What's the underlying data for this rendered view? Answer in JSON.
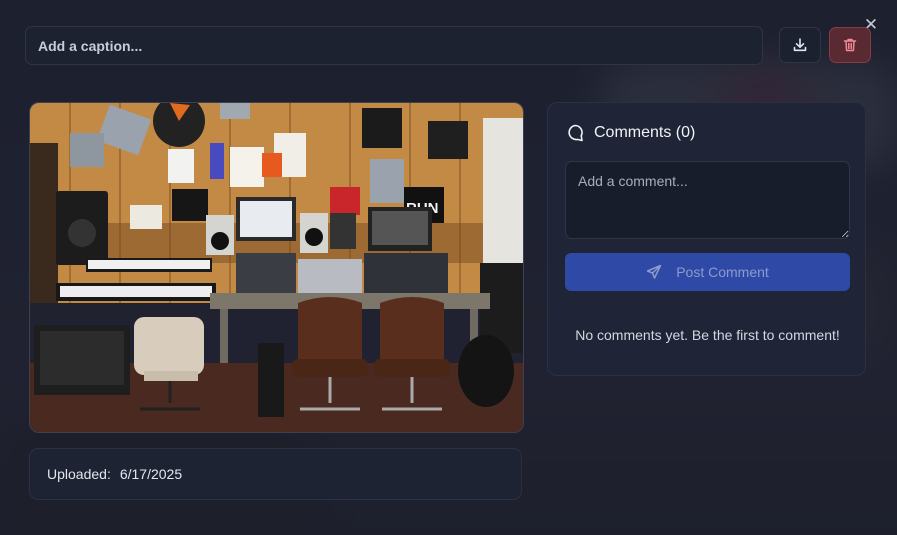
{
  "modal": {
    "caption": {
      "placeholder": "Add a caption...",
      "value": ""
    },
    "close_icon": "close-icon",
    "download_icon": "download-icon",
    "delete_icon": "trash-icon",
    "photo": {
      "description": "recording studio with keyboards, mixing consoles, speakers, monitors and two brown chairs",
      "badge": "RUN"
    },
    "meta": {
      "uploaded_label": "Uploaded:",
      "uploaded_date": "6/17/2025"
    },
    "comments": {
      "title": "Comments (0)",
      "input_placeholder": "Add a comment...",
      "post_label": "Post Comment",
      "empty_text": "No comments yet. Be the first to comment!"
    }
  },
  "colors": {
    "accent": "#2f4aa6",
    "danger": "#8a3a45",
    "panel": "#1f2436"
  }
}
